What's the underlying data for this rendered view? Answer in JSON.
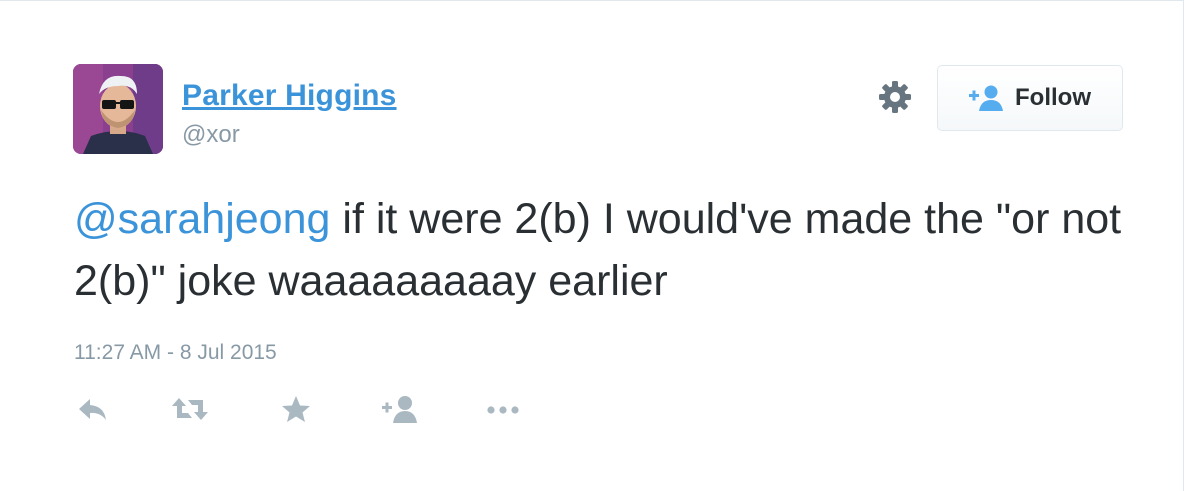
{
  "tweet": {
    "author": {
      "display_name": "Parker Higgins",
      "handle": "@xor"
    },
    "text": {
      "mention": "@sarahjeong",
      "body": " if it were 2(b) I would've made the \"or not 2(b)\" joke waaaaaaaaay earlier"
    },
    "timestamp": "11:27 AM - 8 Jul 2015"
  },
  "header": {
    "follow_label": "Follow"
  },
  "icons": {
    "settings": "gear-icon",
    "follow": "add-user-icon",
    "reply": "reply-icon",
    "retweet": "retweet-icon",
    "favorite": "star-icon",
    "follow_action": "add-user-icon",
    "more": "more-icon"
  },
  "colors": {
    "link": "#3b94d9",
    "text": "#292f33",
    "muted": "#8899a6",
    "icon": "#aab8c2"
  }
}
